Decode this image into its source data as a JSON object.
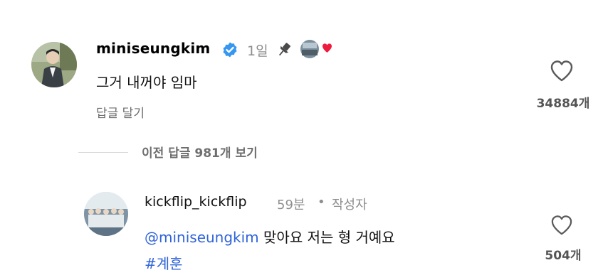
{
  "comment": {
    "username": "miniseungkim",
    "time": "1일",
    "text": "그거 내꺼야 임마",
    "reply_action": "답글 달기",
    "like_count": "34884개",
    "pinned": true,
    "verified": true,
    "liked_by_author": true
  },
  "view_more": {
    "label": "이전 답글 981개 보기"
  },
  "reply": {
    "username": "kickflip_kickflip",
    "time": "59분",
    "separator": "•",
    "author_label": "작성자",
    "mention": "@miniseungkim",
    "text": "맞아요 저는 형 거예요",
    "hashtag": "#계훈",
    "like_count": "504개"
  },
  "colors": {
    "verified": "#3797f0",
    "heart": "#ed1c3e",
    "link": "#2f63d8"
  }
}
